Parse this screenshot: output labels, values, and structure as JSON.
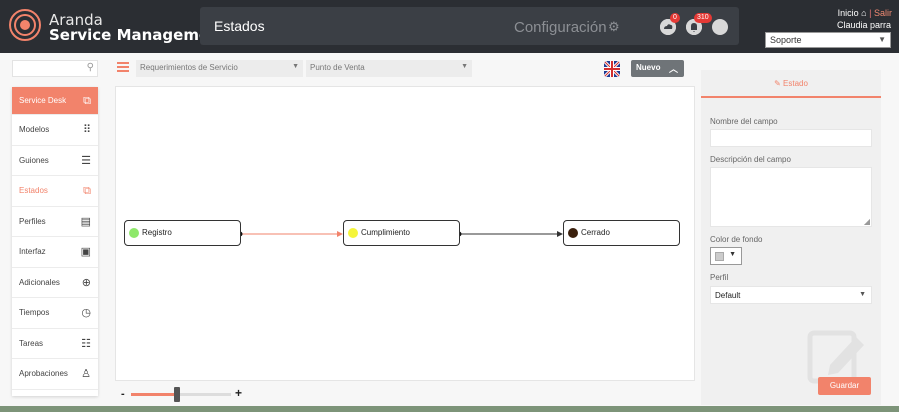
{
  "brand": {
    "line1": "Aranda",
    "line2": "Service Management"
  },
  "header": {
    "page_title": "Estados",
    "config_label": "Configuración",
    "badges": {
      "cloud": "0",
      "notifications": "310"
    },
    "top_links": {
      "home": "Inicio",
      "separator": "|",
      "logout": "Salir"
    },
    "user_name": "Claudia parra",
    "project_select": "Soporte"
  },
  "sidebar": {
    "items": [
      {
        "label": "Service Desk",
        "icon": "copy-icon"
      },
      {
        "label": "Modelos",
        "icon": "grid-icon"
      },
      {
        "label": "Guiones",
        "icon": "document-icon"
      },
      {
        "label": "Estados",
        "icon": "copy-icon"
      },
      {
        "label": "Perfiles",
        "icon": "clipboard-user-icon"
      },
      {
        "label": "Interfaz",
        "icon": "monitor-icon"
      },
      {
        "label": "Adicionales",
        "icon": "plus-circle-icon"
      },
      {
        "label": "Tiempos",
        "icon": "stopwatch-icon"
      },
      {
        "label": "Tareas",
        "icon": "list-icon"
      },
      {
        "label": "Aprobaciones",
        "icon": "stamp-icon"
      }
    ]
  },
  "toolbar": {
    "type_select": "Requerimientos de Servicio",
    "category_select": "Punto de Venta",
    "new_button": "Nuevo"
  },
  "workflow": {
    "nodes": [
      {
        "label": "Registro",
        "color": "#8ee86a"
      },
      {
        "label": "Cumplimiento",
        "color": "#f5f53a"
      },
      {
        "label": "Cerrado",
        "color": "#3a1f0c"
      }
    ],
    "links": [
      {
        "from": "Registro",
        "to": "Cumplimiento",
        "color": "#f2836b"
      },
      {
        "from": "Cumplimiento",
        "to": "Cerrado",
        "color": "#333333"
      }
    ]
  },
  "zoom": {
    "minus": "-",
    "plus": "+",
    "level_fraction": 0.46
  },
  "panel": {
    "tab_label": "Estado",
    "field_name_label": "Nombre del campo",
    "field_name_value": "",
    "field_desc_label": "Descripción del campo",
    "field_desc_value": "",
    "bg_color_label": "Color de fondo",
    "bg_color_value": "#cccccc",
    "profile_label": "Perfil",
    "profile_value": "Default",
    "save_button": "Guardar"
  },
  "colors": {
    "accent": "#f2836b",
    "header_bg": "#2b2e33"
  }
}
